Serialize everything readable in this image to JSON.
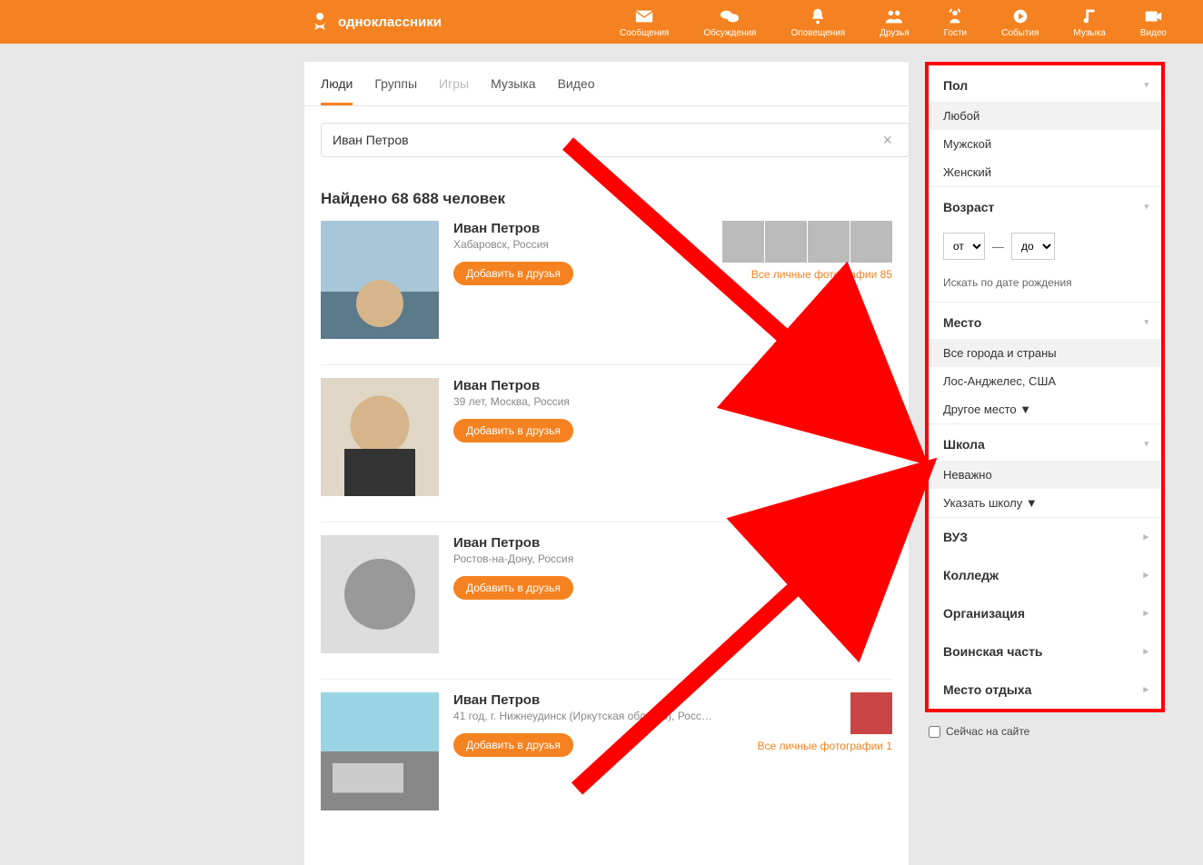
{
  "brand": "одноклассники",
  "nav": [
    {
      "label": "Сообщения"
    },
    {
      "label": "Обсуждения"
    },
    {
      "label": "Оповещения"
    },
    {
      "label": "Друзья"
    },
    {
      "label": "Гости"
    },
    {
      "label": "События"
    },
    {
      "label": "Музыка"
    },
    {
      "label": "Видео"
    }
  ],
  "tabs": {
    "people": "Люди",
    "groups": "Группы",
    "games": "Игры",
    "music": "Музыка",
    "video": "Видео"
  },
  "search": {
    "value": "Иван Петров"
  },
  "results_count": "Найдено 68 688 человек",
  "add_friend_label": "Добавить в друзья",
  "results": [
    {
      "name": "Иван Петров",
      "sub": "Хабаровск, Россия",
      "photos_link": "Все личные фотографии 85",
      "thumbs": 4
    },
    {
      "name": "Иван Петров",
      "sub": "39 лет, Москва, Россия"
    },
    {
      "name": "Иван Петров",
      "sub": "Ростов-на-Дону, Россия"
    },
    {
      "name": "Иван Петров",
      "sub": "41 год, г. Нижнеудинск (Иркутская область), Росс…",
      "photos_link": "Все личные фотографии 1",
      "thumbs": 1
    }
  ],
  "filters": {
    "gender": {
      "title": "Пол",
      "options": [
        "Любой",
        "Мужской",
        "Женский"
      ],
      "selected": 0
    },
    "age": {
      "title": "Возраст",
      "from": "от",
      "to": "до",
      "link": "Искать по дате рождения"
    },
    "place": {
      "title": "Место",
      "options": [
        "Все города и страны",
        "Лос-Анджелес, США",
        "Другое место ▼"
      ],
      "selected": 0
    },
    "school": {
      "title": "Школа",
      "options": [
        "Неважно",
        "Указать школу ▼"
      ],
      "selected": 0
    },
    "collapsed": [
      "ВУЗ",
      "Колледж",
      "Организация",
      "Воинская часть",
      "Место отдыха"
    ]
  },
  "online_now": "Сейчас на сайте"
}
